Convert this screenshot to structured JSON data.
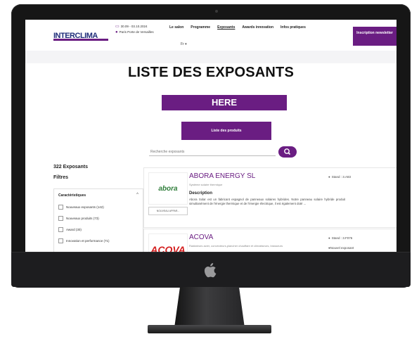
{
  "header": {
    "logo": "INTERCLIMA",
    "date": "30.09 - 03.10.2024",
    "location": "Paris Porte de Versailles",
    "nav": [
      "Le salon",
      "Programme",
      "Exposants",
      "Awards innovation",
      "Infos pratiques"
    ],
    "nav_active": "Exposants",
    "lang": "Fr",
    "cta": "Inscription newsletter"
  },
  "main": {
    "title": "LISTE DES EXPOSANTS",
    "here_label": "HERE",
    "products_button": "Liste des produits",
    "search_placeholder": "Recherche exposants"
  },
  "sidebar": {
    "count": "322 Exposants",
    "filters_title": "Filtres",
    "group_title": "Caractéristiques",
    "items": [
      "Nouveaux exposants (142)",
      "Nouveaux produits (73)",
      "Award (30)",
      "Innovation et performance (71)"
    ]
  },
  "exhibitors": [
    {
      "name": "ABORA ENERGY SL",
      "logo_text": "abora",
      "subtitle": "Système solaire thermique",
      "desc_title": "Description",
      "description": "Abora Solar est un fabricant espagnol de panneaux solaires hybrides. Notre panneau solaire hybride produit simultanément de l'énergie thermique et de l'énergie électrique, il est également doté ...",
      "more": "NOUVEAU APPAR...",
      "stand": "Stand : 3.A83"
    },
    {
      "name": "ACOVA",
      "logo_text": "ACOVA",
      "subtitle": "Radiateurs acier, convecteurs,plancher chauffant et climatiseurs, brasseurs",
      "stand": "Stand : 3.F076",
      "extra": "Nouvel exposant"
    }
  ],
  "colors": {
    "accent": "#6a1d82",
    "text": "#222222"
  }
}
